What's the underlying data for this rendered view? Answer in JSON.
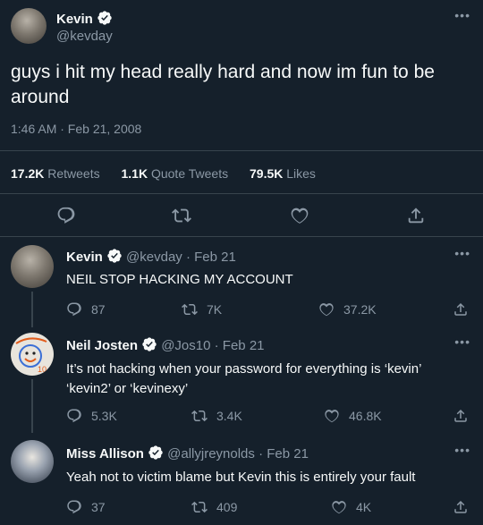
{
  "main_tweet": {
    "name": "Kevin",
    "handle": "@kevday",
    "text": "guys i hit my head really hard and now im fun to be around",
    "time": "1:46 AM · Feb 21, 2008",
    "retweets_count": "17.2K",
    "retweets_label": "Retweets",
    "quotes_count": "1.1K",
    "quotes_label": "Quote Tweets",
    "likes_count": "79.5K",
    "likes_label": "Likes"
  },
  "replies": [
    {
      "name": "Kevin",
      "handle": "@kevday",
      "date": "· Feb 21",
      "text": "NEIL STOP HACKING MY ACCOUNT",
      "replies": "87",
      "retweets": "7K",
      "likes": "37.2K"
    },
    {
      "name": "Neil Josten",
      "handle": "@Jos10",
      "date": "· Feb 21",
      "text": "It’s not hacking when your password for everything is ‘kevin’ ‘kevin2’ or ‘kevinexy’",
      "replies": "5.3K",
      "retweets": "3.4K",
      "likes": "46.8K",
      "avatar_text": "10"
    },
    {
      "name": "Miss Allison",
      "handle": "@allyjreynolds",
      "date": "· Feb 21",
      "text": "Yeah not to victim blame but Kevin this is entirely your fault",
      "replies": "37",
      "retweets": "409",
      "likes": "4K"
    }
  ],
  "colors": {
    "background": "#15202b",
    "text": "#f7f9f9",
    "muted": "#8b98a5",
    "verified": "#1d9bf0",
    "border": "#38444d"
  },
  "icons": {
    "more": "more-dots-icon",
    "reply": "reply-icon",
    "retweet": "retweet-icon",
    "like": "heart-icon",
    "share": "share-icon",
    "verified": "verified-badge-icon"
  },
  "more_glyph": "•••"
}
